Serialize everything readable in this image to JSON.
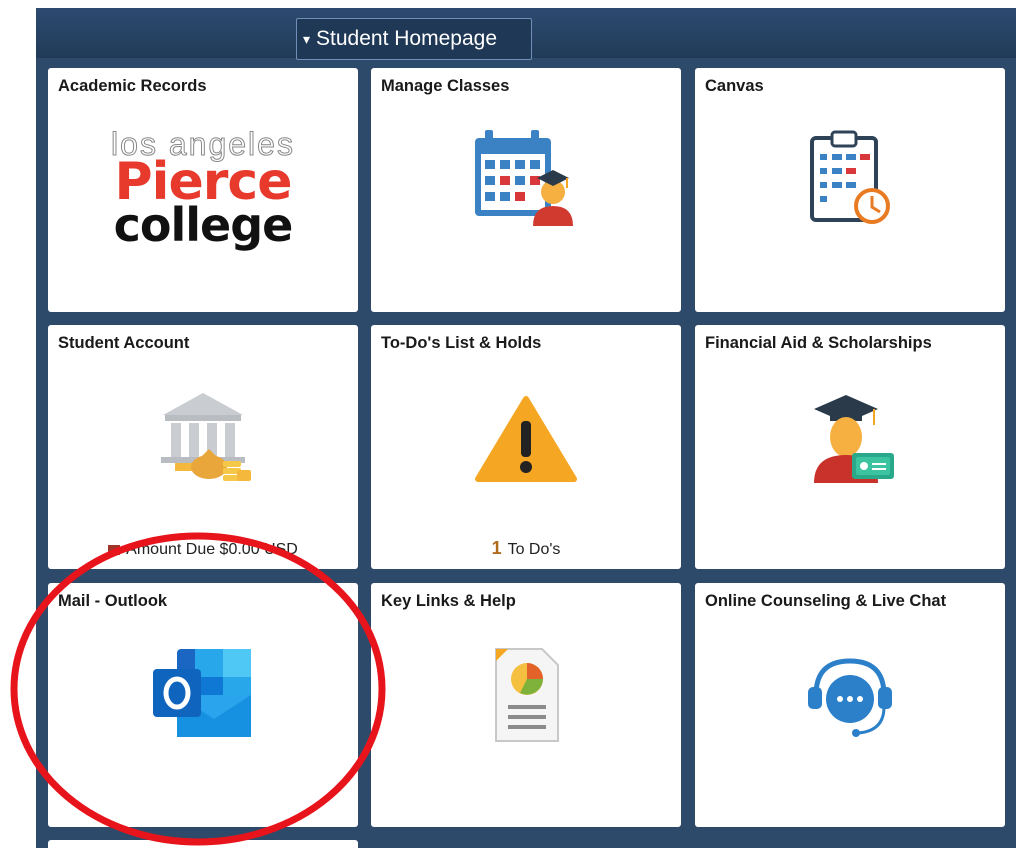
{
  "header": {
    "homepage_label": "Student Homepage",
    "caret": "▾"
  },
  "tiles": [
    {
      "title": "Academic Records",
      "icon": "pierce-college-logo",
      "logo_line1": "los angeles",
      "logo_line2": "Pierce",
      "logo_line3": "college"
    },
    {
      "title": "Manage Classes",
      "icon": "calendar-student-icon"
    },
    {
      "title": "Canvas",
      "icon": "clipboard-clock-icon"
    },
    {
      "title": "Student Account",
      "icon": "bank-money-icon",
      "footer": "Amount Due $0.00 USD"
    },
    {
      "title": "To-Do's List & Holds",
      "icon": "warning-icon",
      "footer_count": "1",
      "footer": "To Do's"
    },
    {
      "title": "Financial Aid & Scholarships",
      "icon": "graduate-card-icon"
    },
    {
      "title": "Mail - Outlook",
      "icon": "outlook-icon"
    },
    {
      "title": "Key Links & Help",
      "icon": "document-chart-icon"
    },
    {
      "title": "Online Counseling & Live Chat",
      "icon": "headset-chat-icon"
    }
  ],
  "colors": {
    "frame": "#2e4a6a",
    "annotation_circle": "#e8141b",
    "accent_orange": "#f5a623"
  }
}
